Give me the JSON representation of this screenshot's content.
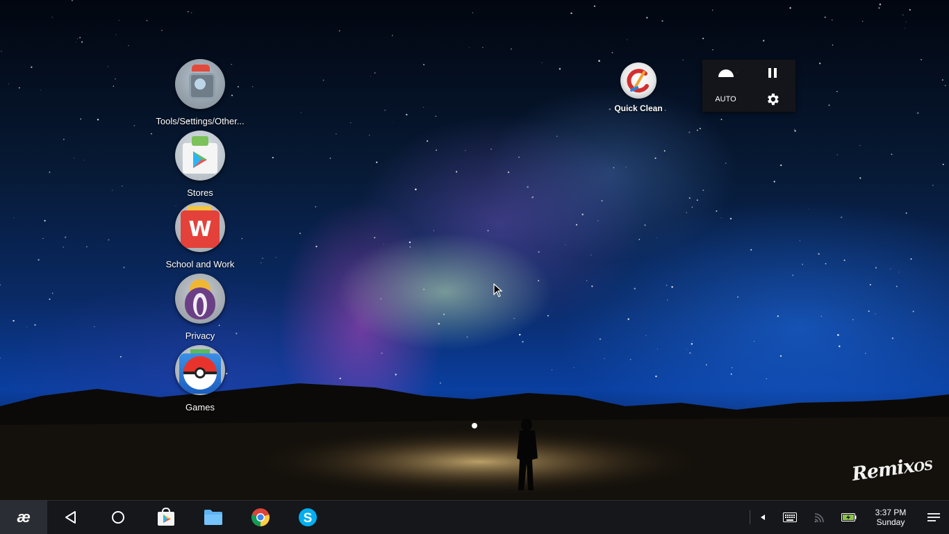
{
  "desktop": {
    "icons": [
      {
        "label": "Tools/Settings/Other..."
      },
      {
        "label": "Stores"
      },
      {
        "label": "School and Work"
      },
      {
        "label": "Privacy"
      },
      {
        "label": "Games"
      }
    ],
    "quick_clean": {
      "label": "Quick Clean"
    },
    "media_panel": {
      "mode_label": "AUTO"
    },
    "logo_text": "Remix",
    "logo_suffix": "OS"
  },
  "taskbar": {
    "pinned_apps": [
      "Play Store",
      "File Manager",
      "Chrome",
      "Skype"
    ],
    "clock": {
      "time": "3:37 PM",
      "day": "Sunday"
    },
    "colors": {
      "background": "#15171b",
      "start": "#2a2d33"
    }
  }
}
